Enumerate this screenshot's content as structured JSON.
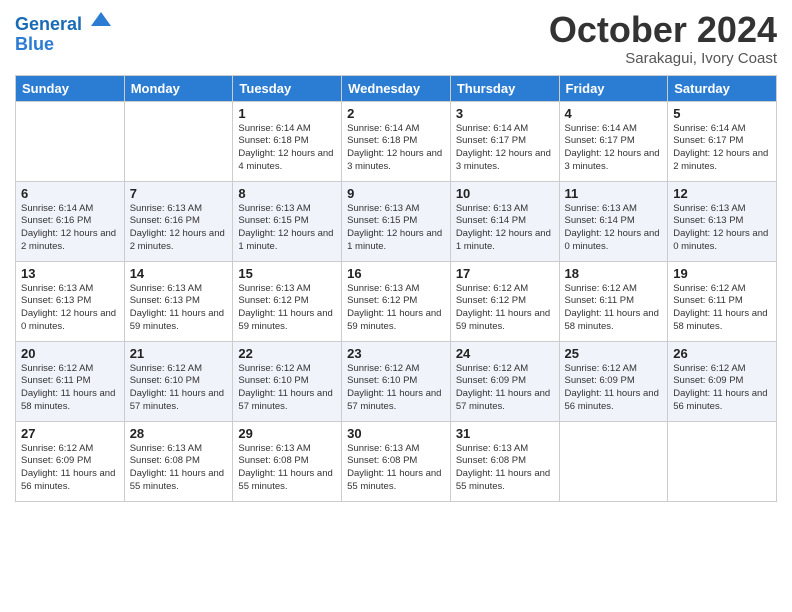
{
  "logo": {
    "line1": "General",
    "line2": "Blue"
  },
  "title": "October 2024",
  "location": "Sarakagui, Ivory Coast",
  "days_of_week": [
    "Sunday",
    "Monday",
    "Tuesday",
    "Wednesday",
    "Thursday",
    "Friday",
    "Saturday"
  ],
  "weeks": [
    [
      {
        "day": "",
        "sunrise": "",
        "sunset": "",
        "daylight": ""
      },
      {
        "day": "",
        "sunrise": "",
        "sunset": "",
        "daylight": ""
      },
      {
        "day": "1",
        "sunrise": "Sunrise: 6:14 AM",
        "sunset": "Sunset: 6:18 PM",
        "daylight": "Daylight: 12 hours and 4 minutes."
      },
      {
        "day": "2",
        "sunrise": "Sunrise: 6:14 AM",
        "sunset": "Sunset: 6:18 PM",
        "daylight": "Daylight: 12 hours and 3 minutes."
      },
      {
        "day": "3",
        "sunrise": "Sunrise: 6:14 AM",
        "sunset": "Sunset: 6:17 PM",
        "daylight": "Daylight: 12 hours and 3 minutes."
      },
      {
        "day": "4",
        "sunrise": "Sunrise: 6:14 AM",
        "sunset": "Sunset: 6:17 PM",
        "daylight": "Daylight: 12 hours and 3 minutes."
      },
      {
        "day": "5",
        "sunrise": "Sunrise: 6:14 AM",
        "sunset": "Sunset: 6:17 PM",
        "daylight": "Daylight: 12 hours and 2 minutes."
      }
    ],
    [
      {
        "day": "6",
        "sunrise": "Sunrise: 6:14 AM",
        "sunset": "Sunset: 6:16 PM",
        "daylight": "Daylight: 12 hours and 2 minutes."
      },
      {
        "day": "7",
        "sunrise": "Sunrise: 6:13 AM",
        "sunset": "Sunset: 6:16 PM",
        "daylight": "Daylight: 12 hours and 2 minutes."
      },
      {
        "day": "8",
        "sunrise": "Sunrise: 6:13 AM",
        "sunset": "Sunset: 6:15 PM",
        "daylight": "Daylight: 12 hours and 1 minute."
      },
      {
        "day": "9",
        "sunrise": "Sunrise: 6:13 AM",
        "sunset": "Sunset: 6:15 PM",
        "daylight": "Daylight: 12 hours and 1 minute."
      },
      {
        "day": "10",
        "sunrise": "Sunrise: 6:13 AM",
        "sunset": "Sunset: 6:14 PM",
        "daylight": "Daylight: 12 hours and 1 minute."
      },
      {
        "day": "11",
        "sunrise": "Sunrise: 6:13 AM",
        "sunset": "Sunset: 6:14 PM",
        "daylight": "Daylight: 12 hours and 0 minutes."
      },
      {
        "day": "12",
        "sunrise": "Sunrise: 6:13 AM",
        "sunset": "Sunset: 6:13 PM",
        "daylight": "Daylight: 12 hours and 0 minutes."
      }
    ],
    [
      {
        "day": "13",
        "sunrise": "Sunrise: 6:13 AM",
        "sunset": "Sunset: 6:13 PM",
        "daylight": "Daylight: 12 hours and 0 minutes."
      },
      {
        "day": "14",
        "sunrise": "Sunrise: 6:13 AM",
        "sunset": "Sunset: 6:13 PM",
        "daylight": "Daylight: 11 hours and 59 minutes."
      },
      {
        "day": "15",
        "sunrise": "Sunrise: 6:13 AM",
        "sunset": "Sunset: 6:12 PM",
        "daylight": "Daylight: 11 hours and 59 minutes."
      },
      {
        "day": "16",
        "sunrise": "Sunrise: 6:13 AM",
        "sunset": "Sunset: 6:12 PM",
        "daylight": "Daylight: 11 hours and 59 minutes."
      },
      {
        "day": "17",
        "sunrise": "Sunrise: 6:12 AM",
        "sunset": "Sunset: 6:12 PM",
        "daylight": "Daylight: 11 hours and 59 minutes."
      },
      {
        "day": "18",
        "sunrise": "Sunrise: 6:12 AM",
        "sunset": "Sunset: 6:11 PM",
        "daylight": "Daylight: 11 hours and 58 minutes."
      },
      {
        "day": "19",
        "sunrise": "Sunrise: 6:12 AM",
        "sunset": "Sunset: 6:11 PM",
        "daylight": "Daylight: 11 hours and 58 minutes."
      }
    ],
    [
      {
        "day": "20",
        "sunrise": "Sunrise: 6:12 AM",
        "sunset": "Sunset: 6:11 PM",
        "daylight": "Daylight: 11 hours and 58 minutes."
      },
      {
        "day": "21",
        "sunrise": "Sunrise: 6:12 AM",
        "sunset": "Sunset: 6:10 PM",
        "daylight": "Daylight: 11 hours and 57 minutes."
      },
      {
        "day": "22",
        "sunrise": "Sunrise: 6:12 AM",
        "sunset": "Sunset: 6:10 PM",
        "daylight": "Daylight: 11 hours and 57 minutes."
      },
      {
        "day": "23",
        "sunrise": "Sunrise: 6:12 AM",
        "sunset": "Sunset: 6:10 PM",
        "daylight": "Daylight: 11 hours and 57 minutes."
      },
      {
        "day": "24",
        "sunrise": "Sunrise: 6:12 AM",
        "sunset": "Sunset: 6:09 PM",
        "daylight": "Daylight: 11 hours and 57 minutes."
      },
      {
        "day": "25",
        "sunrise": "Sunrise: 6:12 AM",
        "sunset": "Sunset: 6:09 PM",
        "daylight": "Daylight: 11 hours and 56 minutes."
      },
      {
        "day": "26",
        "sunrise": "Sunrise: 6:12 AM",
        "sunset": "Sunset: 6:09 PM",
        "daylight": "Daylight: 11 hours and 56 minutes."
      }
    ],
    [
      {
        "day": "27",
        "sunrise": "Sunrise: 6:12 AM",
        "sunset": "Sunset: 6:09 PM",
        "daylight": "Daylight: 11 hours and 56 minutes."
      },
      {
        "day": "28",
        "sunrise": "Sunrise: 6:13 AM",
        "sunset": "Sunset: 6:08 PM",
        "daylight": "Daylight: 11 hours and 55 minutes."
      },
      {
        "day": "29",
        "sunrise": "Sunrise: 6:13 AM",
        "sunset": "Sunset: 6:08 PM",
        "daylight": "Daylight: 11 hours and 55 minutes."
      },
      {
        "day": "30",
        "sunrise": "Sunrise: 6:13 AM",
        "sunset": "Sunset: 6:08 PM",
        "daylight": "Daylight: 11 hours and 55 minutes."
      },
      {
        "day": "31",
        "sunrise": "Sunrise: 6:13 AM",
        "sunset": "Sunset: 6:08 PM",
        "daylight": "Daylight: 11 hours and 55 minutes."
      },
      {
        "day": "",
        "sunrise": "",
        "sunset": "",
        "daylight": ""
      },
      {
        "day": "",
        "sunrise": "",
        "sunset": "",
        "daylight": ""
      }
    ]
  ]
}
